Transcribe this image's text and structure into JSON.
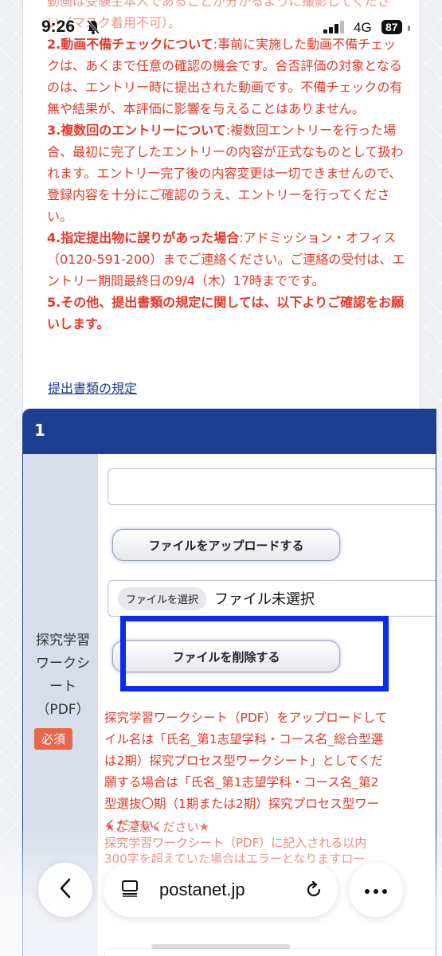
{
  "status_bar": {
    "time": "9:26",
    "network": "4G",
    "battery": "87"
  },
  "notice": {
    "line0": "動画は受験生本人であることが分かるように撮影してくださ",
    "line0b": "い（マスク着用不可）。",
    "item2_title": "2.動画不備チェックについて",
    "item2_body": ":事前に実施した動画不備チェックは、あくまで任意の確認の機会です。合否評価の対象となるのは、エントリー時に提出された動画です。不備チェックの有無や結果が、本評価に影響を与えることはありません。",
    "item3_title": "3.複数回のエントリーについて",
    "item3_body": ":複数回エントリーを行った場合、最初に完了したエントリーの内容が正式なものとして扱われます。エントリー完了後の内容変更は一切できませんので、登録内容を十分にご確認のうえ、エントリーを行ってください。",
    "item4_title": "4.指定提出物に誤りがあった場合",
    "item4_body": ":アドミッション・オフィス（0120-591-200）までご連絡ください。ご連絡の受付は、エントリー期間最終日の9/4（木）17時までです。",
    "item5": "5.その他、提出書類の規定に関しては、以下よりご確認をお願いします。"
  },
  "rules_link": "提出書類の規定",
  "card": {
    "number": "1",
    "label": "探究学習ワークシート（PDF）",
    "required": "必須",
    "upload_button": "ファイルをアップロードする",
    "file_choose": "ファイルを選択",
    "file_status": "ファイル未選択",
    "delete_button": "ファイルを削除する",
    "desc_lines": [
      "探究学習ワークシート（PDF）をアップロードして",
      "イル名は「氏名_第1志望学科・コース名_総合型選",
      "は2期）探究プロセス型ワークシート」としてくだ",
      "願する場合は「氏名_第1志望学科・コース名_第2",
      "型選抜〇期（1期または2期）探究プロセス型ワー",
      "ください。"
    ],
    "caution": "★ご注意ください★",
    "caution_line1": "探究学習ワークシート（PDF）に記入される以内",
    "caution_line2": "300字を超えていた場合はエラーとなりますロー"
  },
  "toolbar": {
    "url": "postanet.jp"
  }
}
